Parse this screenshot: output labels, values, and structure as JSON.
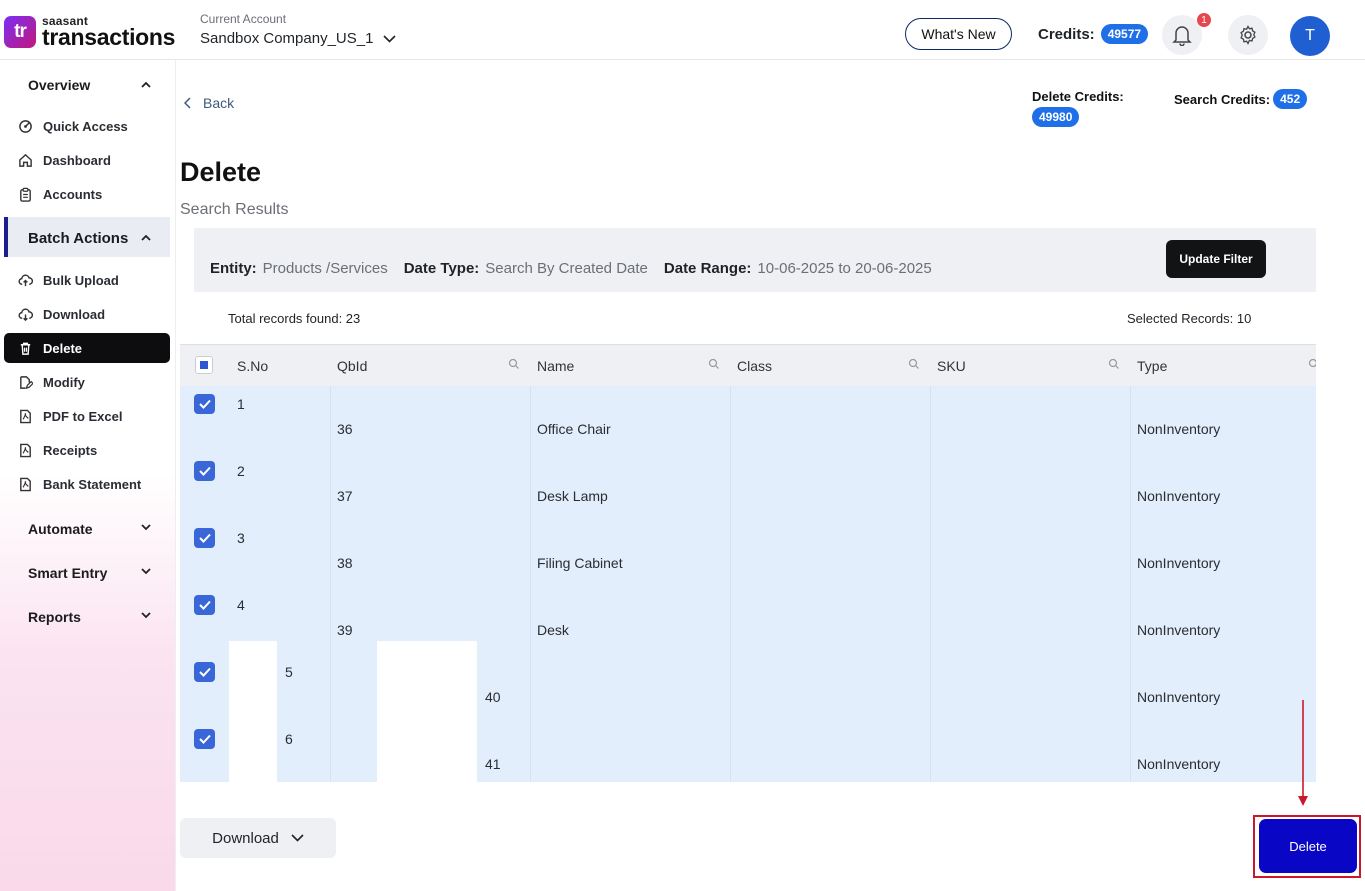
{
  "header": {
    "logo_brand": "saasant",
    "logo_name": "transactions",
    "logo_mark": "tr",
    "account_label": "Current Account",
    "account_value": "Sandbox Company_US_1",
    "whats_new": "What's New",
    "credits_label": "Credits:",
    "credits_value": "49577",
    "notification_count": "1",
    "avatar_initial": "T"
  },
  "sidebar": {
    "overview": "Overview",
    "overview_items": [
      "Quick Access",
      "Dashboard",
      "Accounts"
    ],
    "batch_actions": "Batch Actions",
    "batch_items": [
      "Bulk Upload",
      "Download",
      "Delete",
      "Modify",
      "PDF to Excel",
      "Receipts",
      "Bank Statement"
    ],
    "active_item": "Delete",
    "automate": "Automate",
    "smart_entry": "Smart Entry",
    "reports": "Reports"
  },
  "main": {
    "back": "Back",
    "delete_credits_label": "Delete Credits:",
    "delete_credits_value": "49980",
    "search_credits_label": "Search Credits:",
    "search_credits_value": "452",
    "title": "Delete",
    "subtitle": "Search Results",
    "filter": {
      "entity_label": "Entity:",
      "entity_value": "Products /Services",
      "date_type_label": "Date Type:",
      "date_type_value": "Search By Created Date",
      "date_range_label": "Date Range:",
      "date_range_value": "10-06-2025 to 20-06-2025",
      "update_button": "Update Filter"
    },
    "total_records": "Total records found: 23",
    "selected_records": "Selected Records: 10"
  },
  "table": {
    "columns": [
      "S.No",
      "QbId",
      "Name",
      "Class",
      "SKU",
      "Type"
    ],
    "rows": [
      {
        "sno": "1",
        "qbid": "36",
        "name": "Office Chair",
        "class": "",
        "sku": "",
        "type": "NonInventory"
      },
      {
        "sno": "2",
        "qbid": "37",
        "name": "Desk Lamp",
        "class": "",
        "sku": "",
        "type": "NonInventory"
      },
      {
        "sno": "3",
        "qbid": "38",
        "name": "Filing Cabinet",
        "class": "",
        "sku": "",
        "type": "NonInventory"
      },
      {
        "sno": "4",
        "qbid": "39",
        "name": "Desk",
        "class": "",
        "sku": "",
        "type": "NonInventory"
      },
      {
        "sno": "5",
        "qbid": "40",
        "name": "",
        "class": "",
        "sku": "",
        "type": "NonInventory"
      },
      {
        "sno": "6",
        "qbid": "41",
        "name": "",
        "class": "",
        "sku": "",
        "type": "NonInventory"
      }
    ]
  },
  "footer": {
    "download_button": "Download",
    "delete_button": "Delete"
  },
  "colors": {
    "accent_blue": "#1f6fe8",
    "delete_button": "#0a06c6",
    "highlight_red": "#c8192c",
    "row_selected": "#e2eefb"
  }
}
